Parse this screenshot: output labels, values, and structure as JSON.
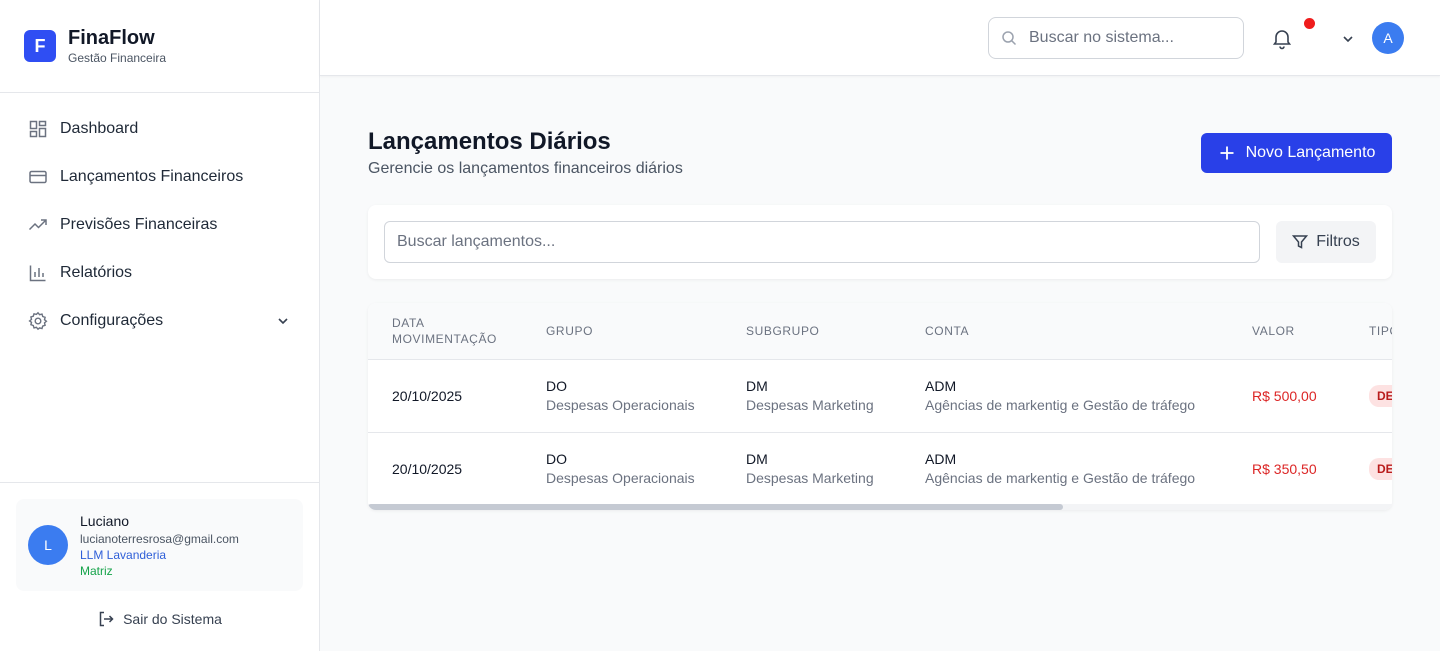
{
  "brand": {
    "logo_letter": "F",
    "name": "FinaFlow",
    "subtitle": "Gestão Financeira",
    "color": "#2f4ef3"
  },
  "sidebar": {
    "items": [
      {
        "label": "Dashboard",
        "icon": "dashboard-grid-icon"
      },
      {
        "label": "Lançamentos Financeiros",
        "icon": "credit-card-icon"
      },
      {
        "label": "Previsões Financeiras",
        "icon": "trending-up-icon"
      },
      {
        "label": "Relatórios",
        "icon": "bar-chart-icon"
      },
      {
        "label": "Configurações",
        "icon": "gear-icon",
        "has_submenu": true
      }
    ]
  },
  "user": {
    "initial": "L",
    "name": "Luciano",
    "email": "lucianoterresrosa@gmail.com",
    "company": "LLM Lavanderia",
    "branch": "Matriz",
    "logout_label": "Sair do Sistema"
  },
  "topbar": {
    "search_placeholder": "Buscar no sistema...",
    "avatar_initial": "A",
    "notification_dot_color": "#ef1c1c"
  },
  "page": {
    "title": "Lançamentos Diários",
    "subtitle": "Gerencie os lançamentos financeiros diários",
    "new_button_label": "Novo Lançamento",
    "accent_color": "#2940e8"
  },
  "filters": {
    "search_placeholder": "Buscar lançamentos...",
    "filter_button_label": "Filtros"
  },
  "table": {
    "headers": {
      "data_line1": "DATA",
      "data_line2": "MOVIMENTAÇÃO",
      "grupo": "GRUPO",
      "subgrupo": "SUBGRUPO",
      "conta": "CONTA",
      "valor": "VALOR",
      "tipo": "TIPO"
    },
    "rows": [
      {
        "data": "20/10/2025",
        "grupo_code": "DO",
        "grupo_desc": "Despesas Operacionais",
        "subgrupo_code": "DM",
        "subgrupo_desc": "Despesas Marketing",
        "conta_code": "ADM",
        "conta_desc": "Agências de markentig e Gestão de tráfego",
        "valor": "R$ 500,00",
        "tipo": "DE"
      },
      {
        "data": "20/10/2025",
        "grupo_code": "DO",
        "grupo_desc": "Despesas Operacionais",
        "subgrupo_code": "DM",
        "subgrupo_desc": "Despesas Marketing",
        "conta_code": "ADM",
        "conta_desc": "Agências de markentig e Gestão de tráfego",
        "valor": "R$ 350,50",
        "tipo": "DE"
      }
    ]
  }
}
